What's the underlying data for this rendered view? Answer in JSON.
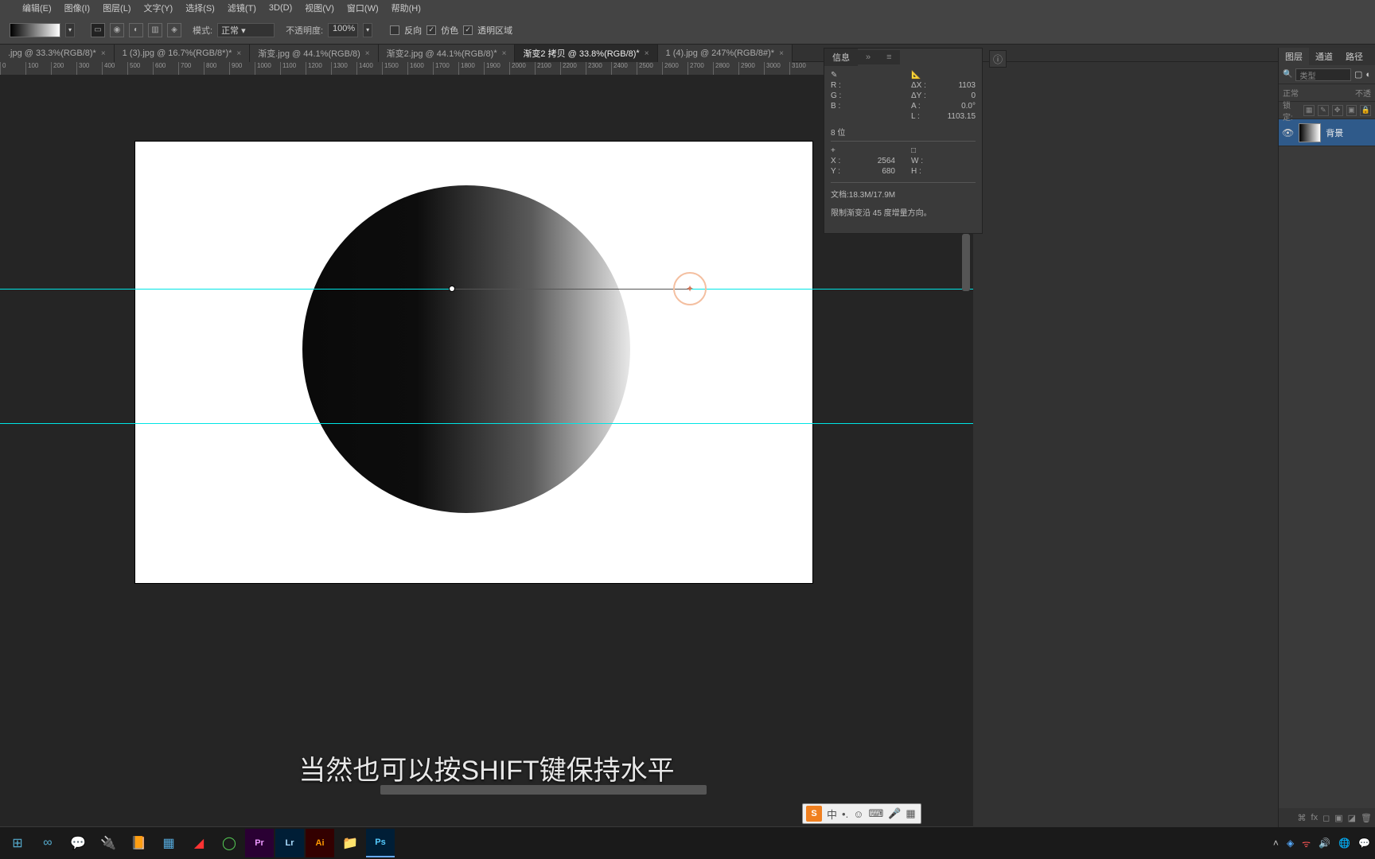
{
  "menu": {
    "items": [
      "编辑(E)",
      "图像(I)",
      "图层(L)",
      "文字(Y)",
      "选择(S)",
      "滤镜(T)",
      "3D(D)",
      "视图(V)",
      "窗口(W)",
      "帮助(H)"
    ]
  },
  "options": {
    "mode_label": "模式:",
    "mode_value": "正常",
    "opacity_label": "不透明度:",
    "opacity_value": "100%",
    "reverse": "反向",
    "dither": "仿色",
    "transparency": "透明区域"
  },
  "tabs": [
    {
      "label": ".jpg @ 33.3%(RGB/8)",
      "star": true
    },
    {
      "label": "1 (3).jpg @ 16.7%(RGB/8*)",
      "star": true
    },
    {
      "label": "渐变.jpg @ 44.1%(RGB/8)",
      "star": false
    },
    {
      "label": "渐变2.jpg @ 44.1%(RGB/8)",
      "star": true
    },
    {
      "label": "渐变2 拷贝 @ 33.8%(RGB/8)",
      "star": true,
      "active": true
    },
    {
      "label": "1 (4).jpg @ 247%(RGB/8#)",
      "star": true
    }
  ],
  "ruler_ticks": [
    "0",
    "100",
    "200",
    "300",
    "400",
    "500",
    "600",
    "700",
    "800",
    "900",
    "1000",
    "1100",
    "1200",
    "1300",
    "1400",
    "1500",
    "1600",
    "1700",
    "1800",
    "1900",
    "2000",
    "2100",
    "2200",
    "2300",
    "2400",
    "2500",
    "2600",
    "2700",
    "2800",
    "2900",
    "3000",
    "3100"
  ],
  "info": {
    "title": "信息",
    "R": "R :",
    "G": "G :",
    "B": "B :",
    "dx": "ΔX :",
    "dx_v": "1103",
    "dy": "ΔY :",
    "dy_v": "0",
    "A": "A :",
    "A_v": "0.0°",
    "L": "L :",
    "L_v": "1103.15",
    "bits": "8 位",
    "X": "X :",
    "X_v": "2564",
    "Y": "Y :",
    "Y_v": "680",
    "W": "W :",
    "H": "H :",
    "doc": "文档:18.3M/17.9M",
    "hint": "限制渐变沿 45 度增量方向。"
  },
  "layers": {
    "tabs": [
      "图层",
      "通道",
      "路径"
    ],
    "type_filter": "类型",
    "blend": "正常",
    "opacity_label": "不透",
    "lock_label": "锁定:",
    "layer_name": "背景"
  },
  "subtitle": "当然也可以按SHIFT键保持水平",
  "status": {
    "docsize": "文档:18.3M/17.9M"
  },
  "ime": {
    "lang": "中"
  },
  "taskbar_icons": [
    "⊞",
    "∞",
    "💬",
    "🔌",
    "📙",
    "📊",
    "🟥",
    "🟢",
    "Pr",
    "Lr",
    "Ai",
    "📁",
    "Ps"
  ]
}
